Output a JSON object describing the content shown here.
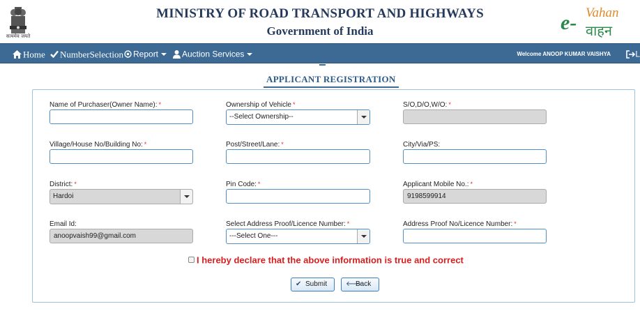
{
  "header": {
    "emblem_caption": "सत्यमेव जयते",
    "ministry": "MINISTRY OF ROAD TRANSPORT AND HIGHWAYS",
    "government": "Government of India",
    "logo_e": "e-",
    "logo_vahan": "Vahan",
    "logo_hindi": "वाहन"
  },
  "navbar": {
    "home": "Home",
    "number_selection": "NumberSelection",
    "report": "Report",
    "auction_services": "Auction Services",
    "welcome": "Welcome ANOOP KUMAR VAISHYA",
    "logout_letter": "L",
    "icons": {
      "home": "home-icon",
      "number_selection": "check-icon",
      "report": "target-icon",
      "auction": "user-icon",
      "logout": "logout-icon"
    }
  },
  "page_title": "APPLICANT REGISTRATION",
  "form": {
    "name_of_purchaser": {
      "label": "Name of Purchaser(Owner Name):",
      "required": "*",
      "value": ""
    },
    "ownership_of_vehicle": {
      "label": "Ownership of Vehicle",
      "required": "*",
      "value": "--Select Ownership--"
    },
    "sodow": {
      "label": "S/O,D/O,W/O:",
      "required": "*",
      "value": ""
    },
    "village_house": {
      "label": "Village/House No/Building No:",
      "required": "*",
      "value": ""
    },
    "post_street": {
      "label": "Post/Street/Lane:",
      "required": "*",
      "value": ""
    },
    "city_via_ps": {
      "label": "City/Via/PS:",
      "value": ""
    },
    "district": {
      "label": "District:",
      "required": "*",
      "value": "Hardoi"
    },
    "pin_code": {
      "label": "Pin Code:",
      "required": "*",
      "value": ""
    },
    "applicant_mobile": {
      "label": "Applicant Mobile No.:",
      "required": "*",
      "value": "9198599914"
    },
    "email": {
      "label": "Email Id:",
      "value": "anoopvaish99@gmail.com"
    },
    "address_proof": {
      "label": "Select Address Proof/Licence Number:",
      "required": "*",
      "value": "---Select One---"
    },
    "address_proof_no": {
      "label": "Address Proof No/Licence Number:",
      "required": "*",
      "value": ""
    }
  },
  "declaration": "I hereby declare that the above information is true and correct",
  "buttons": {
    "submit": "Submit",
    "back": "Back"
  },
  "colors": {
    "navbar": "#3c6a94",
    "title": "#2c5a88",
    "declaration": "#d81e1e",
    "required": "#e03030"
  }
}
